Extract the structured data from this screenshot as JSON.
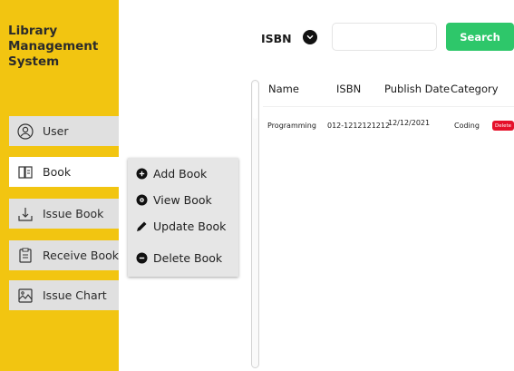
{
  "app": {
    "title": "Library Management System",
    "title_lines": [
      "Library",
      "Management",
      "System"
    ]
  },
  "sidebar": {
    "items": [
      {
        "label": "User",
        "icon": "user-circle-icon"
      },
      {
        "label": "Book",
        "icon": "book-icon",
        "active": true
      },
      {
        "label": "Issue Book",
        "icon": "download-tray-icon"
      },
      {
        "label": "Receive Book",
        "icon": "clipboard-icon"
      },
      {
        "label": "Issue Chart",
        "icon": "chart-image-icon"
      }
    ]
  },
  "book_menu": {
    "items": [
      {
        "label": "Add Book",
        "icon": "plus-circle-icon"
      },
      {
        "label": "View Book",
        "icon": "eye-icon"
      },
      {
        "label": "Update Book",
        "icon": "pencil-icon"
      },
      {
        "label": "Delete Book",
        "icon": "minus-circle-icon"
      }
    ]
  },
  "search": {
    "filter_label": "ISBN",
    "input_value": "",
    "button_label": "Search"
  },
  "table": {
    "columns": [
      "Name",
      "ISBN",
      "Publish Date",
      "Category"
    ],
    "rows": [
      {
        "name": "Programming",
        "isbn": "012-1212121212",
        "publish_date": "12/12/2021",
        "category": "Coding",
        "action": "Delete"
      }
    ]
  },
  "colors": {
    "sidebar": "#f2c511",
    "search_button": "#2ec76a",
    "delete_chip": "#e5102a",
    "nav_item": "#e0e0e0",
    "nav_item_active": "#ffffff"
  }
}
